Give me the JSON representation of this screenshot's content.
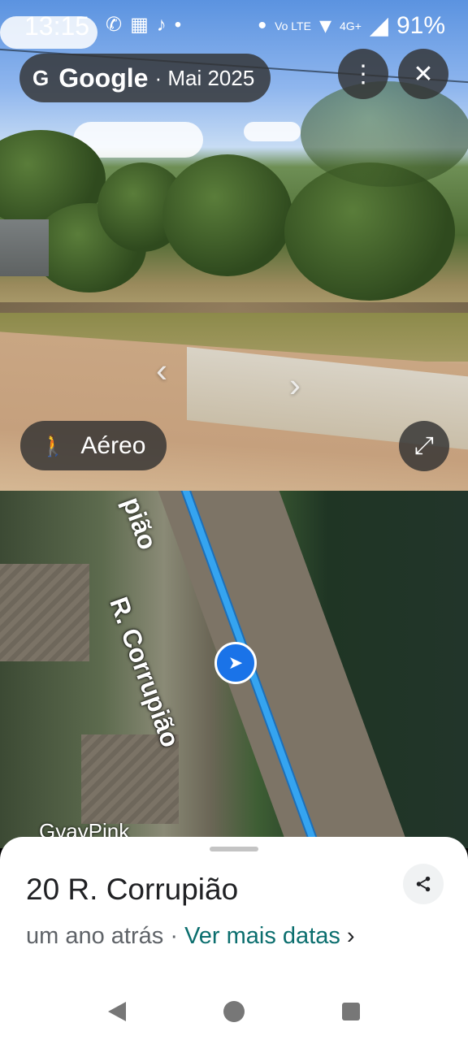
{
  "status_bar": {
    "time": "13:15",
    "notifications": [
      "whatsapp-icon",
      "calendar-icon",
      "tiktok-icon",
      "dot"
    ],
    "network": "4G+",
    "battery": "91%"
  },
  "streetview": {
    "source": "Google",
    "date": "· Mai 2025",
    "mode_button": "Aéreo"
  },
  "aerial": {
    "street_label": "R. Corrupião",
    "street_label_top": "pião",
    "watermark": "GyayPink"
  },
  "sheet": {
    "address": "20 R. Corrupião",
    "age": "um ano atrás",
    "separator": "·",
    "more_dates": "Ver mais datas",
    "chevron": "›"
  }
}
